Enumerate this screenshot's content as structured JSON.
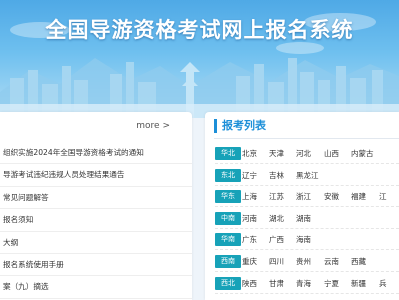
{
  "banner": {
    "title": "全国导游资格考试网上报名系统"
  },
  "notices": {
    "more_label": "more >",
    "items": [
      "组织实施2024年全国导游资格考试的通知",
      "导游考试违纪违规人员处理结果通告",
      "常见问题解答",
      "报名须知",
      "大纲",
      "报名系统使用手册",
      "案（九）摘选"
    ]
  },
  "registration": {
    "title": "报考列表",
    "regions": [
      {
        "name": "华北",
        "provinces": [
          "北京",
          "天津",
          "河北",
          "山西",
          "内蒙古"
        ]
      },
      {
        "name": "东北",
        "provinces": [
          "辽宁",
          "吉林",
          "黑龙江"
        ]
      },
      {
        "name": "华东",
        "provinces": [
          "上海",
          "江苏",
          "浙江",
          "安徽",
          "福建",
          "江"
        ]
      },
      {
        "name": "中南",
        "provinces": [
          "河南",
          "湖北",
          "湖南"
        ]
      },
      {
        "name": "华南",
        "provinces": [
          "广东",
          "广西",
          "海南"
        ]
      },
      {
        "name": "西南",
        "provinces": [
          "重庆",
          "四川",
          "贵州",
          "云南",
          "西藏"
        ]
      },
      {
        "name": "西北",
        "provinces": [
          "陕西",
          "甘肃",
          "青海",
          "宁夏",
          "新疆",
          "兵"
        ]
      }
    ]
  },
  "colors": {
    "accent": "#1c8fd8",
    "region_tag": "#17a2b8"
  }
}
